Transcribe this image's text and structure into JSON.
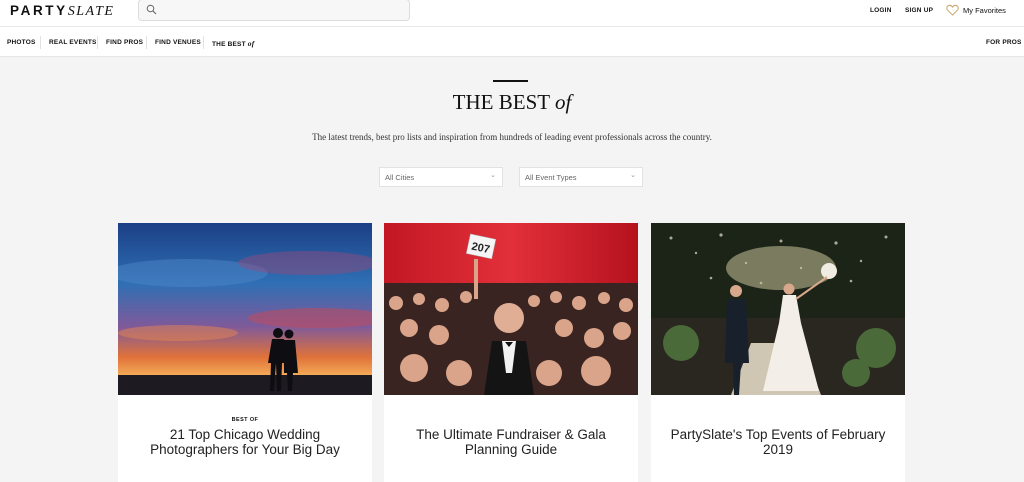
{
  "header": {
    "logo_part1": "PARTY",
    "logo_part2": "SLATE",
    "search_placeholder": "",
    "login": "LOGIN",
    "signup": "SIGN UP",
    "favorites": "My Favorites"
  },
  "nav": {
    "photos": "PHOTOS",
    "real_events": "REAL EVENTS",
    "find_pros": "FIND PROS",
    "find_venues": "FIND VENUES",
    "best_of_main": "THE BEST",
    "best_of_italic": "of",
    "for_pros": "FOR PROS"
  },
  "hero": {
    "title_main": "THE BEST",
    "title_italic": "of",
    "subtitle": "The latest trends, best pro lists and inspiration from hundreds of leading event professionals across the country."
  },
  "filters": {
    "city": "All Cities",
    "event_type": "All Event Types"
  },
  "cards": [
    {
      "kicker": "BEST OF",
      "title": "21 Top Chicago Wedding Photographers for Your Big Day"
    },
    {
      "kicker": "",
      "title": "The Ultimate Fundraiser & Gala Planning Guide"
    },
    {
      "kicker": "",
      "title": "PartySlate's Top Events of February 2019"
    }
  ],
  "photo_text": {
    "paddle_number": "207"
  },
  "colors": {
    "page_bg": "#f4f4f4",
    "text": "#222222",
    "heart_outline": "#c8a86a"
  }
}
